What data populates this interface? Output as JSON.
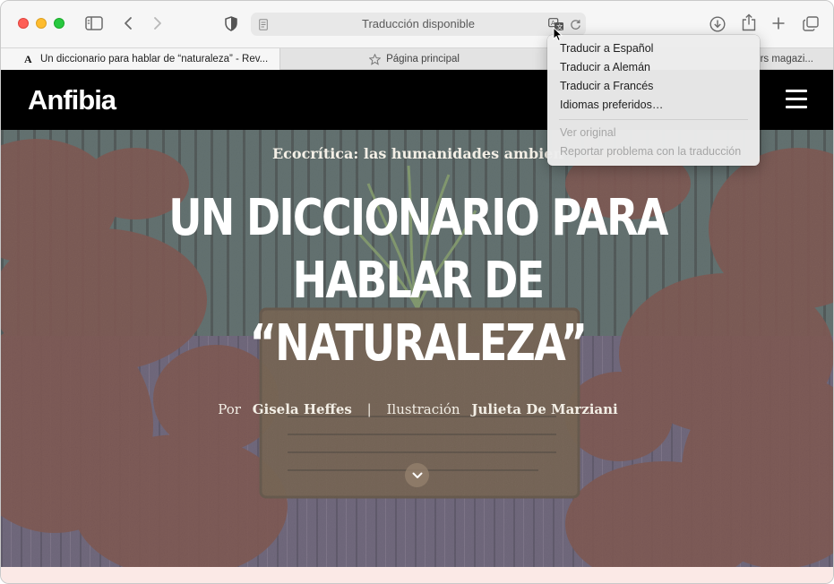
{
  "toolbar": {
    "address_text": "Traducción disponible",
    "icons": [
      "sidebar-icon",
      "back-icon",
      "forward-icon",
      "shield-icon",
      "reader-icon",
      "translate-icon",
      "reload-icon",
      "download-icon",
      "share-icon",
      "new-tab-icon",
      "tab-overview-icon"
    ]
  },
  "tabs": [
    {
      "label": "Un diccionario para hablar de “naturaleza” - Rev...",
      "favicon": "A",
      "active": true
    },
    {
      "label": "Página principal",
      "icon": "star-icon",
      "active": false
    },
    {
      "label": "rs magazi...",
      "active": false
    }
  ],
  "site": {
    "brand": "Anfibia",
    "menu_icon": "hamburger-icon"
  },
  "article": {
    "kicker": "Ecocrítica: las humanidades ambien",
    "headline_lines": [
      "UN DICCIONARIO PARA",
      "HABLAR DE",
      "“NATURALEZA”"
    ],
    "by_prefix": "Por",
    "author": "Gisela Heffes",
    "separator": "|",
    "illustration_prefix": "Ilustración",
    "illustrator": "Julieta De Marziani"
  },
  "translate_menu": {
    "items": [
      {
        "label": "Traducir a Español",
        "enabled": true
      },
      {
        "label": "Traducir a Alemán",
        "enabled": true
      },
      {
        "label": "Traducir a Francés",
        "enabled": true
      },
      {
        "label": "Idiomas preferidos…",
        "enabled": true
      },
      {
        "label": "Ver original",
        "enabled": false
      },
      {
        "label": "Reportar problema con la traducción",
        "enabled": false
      }
    ]
  },
  "colors": {
    "header_bg": "#000000",
    "hero_teal": "#4f6e6c",
    "hero_red": "#8b3a2e",
    "hero_purple": "#7a5a8a",
    "pink_strip": "#fbe9e6"
  }
}
